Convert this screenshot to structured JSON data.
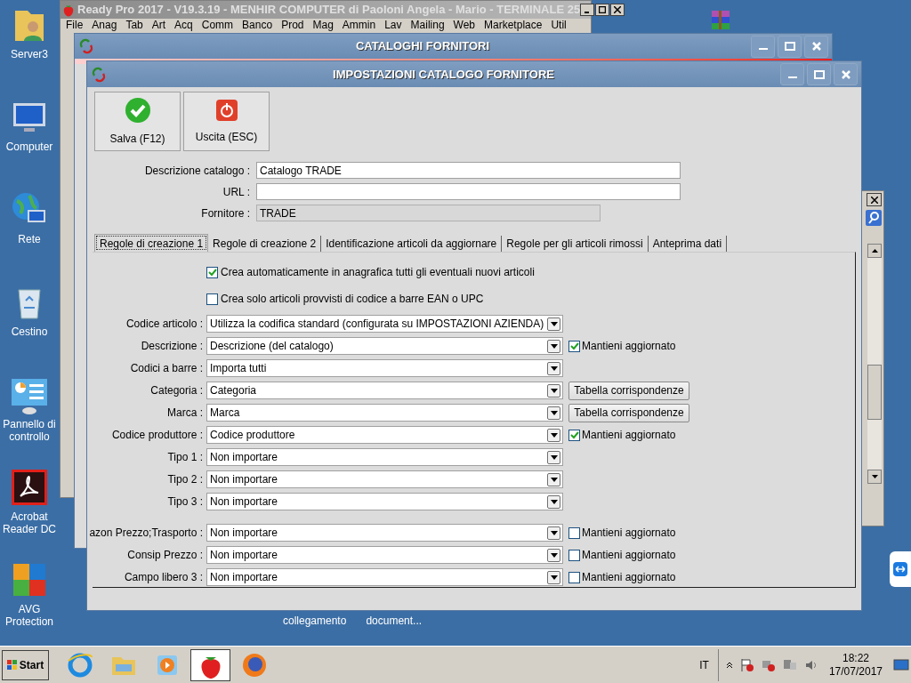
{
  "desktop_icons": [
    {
      "label": "Server3",
      "kind": "user-folder"
    },
    {
      "label": "Computer",
      "kind": "computer"
    },
    {
      "label": "Rete",
      "kind": "network"
    },
    {
      "label": "Cestino",
      "kind": "bin"
    },
    {
      "label": "Pannello di controllo",
      "kind": "panel"
    },
    {
      "label": "Acrobat Reader DC",
      "kind": "pdf"
    },
    {
      "label": "AVG Protection",
      "kind": "avg"
    }
  ],
  "desktop_texts": [
    "collegamento",
    "document..."
  ],
  "back_window": {
    "title": "Ready Pro 2017 - V19.3.19 - MENHIR COMPUTER di Paoloni Angela - Mario - TERMINALE 25",
    "menu": [
      "File",
      "Anag",
      "Tab",
      "Art",
      "Acq",
      "Comm",
      "Banco",
      "Prod",
      "Mag",
      "Ammin",
      "Lav",
      "Mailing",
      "Web",
      "Marketplace",
      "Util"
    ]
  },
  "catalog_window": {
    "title": "CATALOGHI FORNITORI"
  },
  "dialog": {
    "title": "IMPOSTAZIONI CATALOGO FORNITORE",
    "toolbar": [
      {
        "label": "Salva (F12)",
        "kind": "save"
      },
      {
        "label": "Uscita (ESC)",
        "kind": "exit"
      }
    ],
    "fields": [
      {
        "label": "Descrizione catalogo :",
        "value": "Catalogo TRADE",
        "disabled": false
      },
      {
        "label": "URL :",
        "disabled": false
      },
      {
        "label": "Fornitore :",
        "value": "TRADE",
        "disabled": true
      }
    ],
    "tabs": [
      {
        "label": "Regole di creazione 1",
        "selected": true
      },
      {
        "label": "Regole di creazione 2",
        "selected": false
      },
      {
        "label": "Identificazione articoli da aggiornare",
        "selected": false
      },
      {
        "label": "Regole per gli articoli rimossi",
        "selected": false
      },
      {
        "label": "Anteprima dati",
        "selected": false
      }
    ],
    "options": [
      {
        "label": "Crea automaticamente in anagrafica tutti gli eventuali nuovi articoli",
        "checked": true
      },
      {
        "label": "Crea solo articoli provvisti di codice a barre EAN o UPC",
        "checked": false
      }
    ],
    "row_groups": [
      [
        {
          "label": "Codice articolo :",
          "value": "Utilizza la codifica standard (configurata su IMPOSTAZIONI AZIENDA)"
        },
        {
          "label": "Descrizione :",
          "value": "Descrizione (del catalogo)",
          "extra": {
            "kind": "checkbox",
            "label": "Mantieni aggiornato",
            "checked": true
          }
        },
        {
          "label": "Codici a barre :",
          "value": "Importa tutti"
        },
        {
          "label": "Categoria :",
          "value": "Categoria",
          "extra": {
            "kind": "button",
            "label": "Tabella corrispondenze"
          }
        },
        {
          "label": "Marca :",
          "value": "Marca",
          "extra": {
            "kind": "button",
            "label": "Tabella corrispondenze"
          }
        },
        {
          "label": "Codice produttore :",
          "value": "Codice produttore",
          "extra": {
            "kind": "checkbox",
            "label": "Mantieni aggiornato",
            "checked": true
          }
        },
        {
          "label": "Tipo 1 :",
          "value": "Non importare"
        },
        {
          "label": "Tipo 2 :",
          "value": "Non importare"
        },
        {
          "label": "Tipo 3 :",
          "value": "Non importare"
        }
      ],
      [
        {
          "label": "azon Prezzo;Trasporto :",
          "value": "Non importare",
          "extra": {
            "kind": "checkbox",
            "label": "Mantieni aggiornato",
            "checked": false
          }
        },
        {
          "label": "Consip Prezzo :",
          "value": "Non importare",
          "extra": {
            "kind": "checkbox",
            "label": "Mantieni aggiornato",
            "checked": false
          }
        },
        {
          "label": "Campo libero 3 :",
          "value": "Non importare",
          "extra": {
            "kind": "checkbox",
            "label": "Mantieni aggiornato",
            "checked": false
          }
        }
      ]
    ]
  },
  "taskbar": {
    "start": "Start",
    "apps": [
      {
        "kind": "browser",
        "selected": false
      },
      {
        "kind": "folder",
        "selected": false
      },
      {
        "kind": "media",
        "selected": false
      },
      {
        "kind": "strawberry",
        "selected": true
      },
      {
        "kind": "firefox",
        "selected": false
      }
    ],
    "language": "IT",
    "time": "18:22",
    "date": "17/07/2017"
  }
}
